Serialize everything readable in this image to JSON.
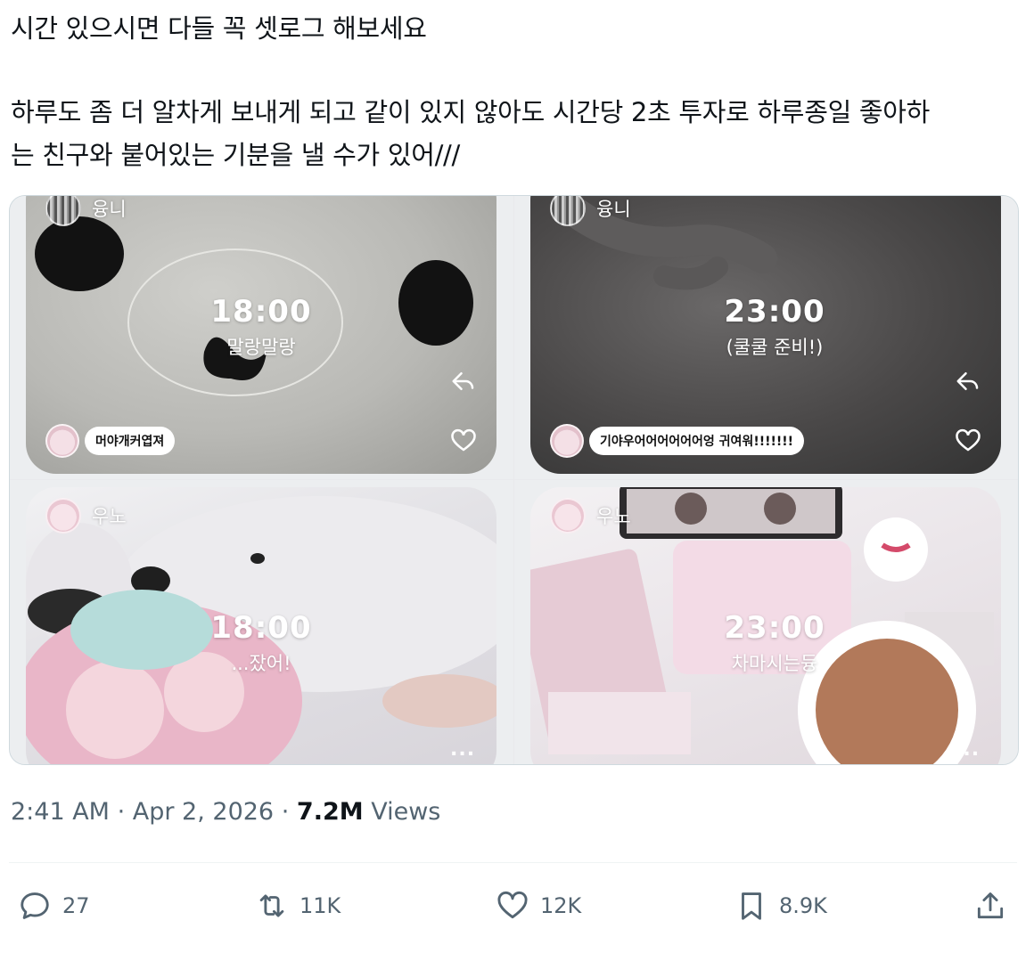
{
  "tweet": {
    "line1": "시간 있으시면 다들 꼭 셋로그 해보세요",
    "line2": "하루도 좀 더 알차게 보내게 되고 같이 있지 않아도 시간당 2초 투자로 하루종일 좋아하",
    "line3": "는 친구와 붙어있는 기분을 낼 수가 있어///"
  },
  "media": {
    "cells": [
      {
        "username": "융니",
        "time": "18:00",
        "caption": "말랑말랑",
        "comment": "머야개커엽져"
      },
      {
        "username": "융니",
        "time": "23:00",
        "caption": "(쿨쿨 준비!)",
        "comment": "기야우어어어어어어엉 귀여워!!!!!!!"
      },
      {
        "username": "우노",
        "time": "18:00",
        "caption": "...잤어!",
        "more": "..."
      },
      {
        "username": "우노",
        "time": "23:00",
        "caption": "차마시는듕",
        "more": "..."
      }
    ]
  },
  "meta": {
    "time": "2:41 AM",
    "sep1": "·",
    "date": "Apr 2, 2026",
    "sep2": "·",
    "views_count": "7.2M",
    "views_label": "Views"
  },
  "actions": {
    "replies": "27",
    "reposts": "11K",
    "likes": "12K",
    "bookmarks": "8.9K"
  },
  "icons": [
    "reply-icon",
    "heart-icon",
    "comment-icon",
    "repost-icon",
    "like-icon",
    "bookmark-icon",
    "share-icon",
    "more-icon"
  ],
  "colors": {
    "secondary_text": "#536471",
    "primary_text": "#0f1419",
    "border": "#cfd9de"
  }
}
